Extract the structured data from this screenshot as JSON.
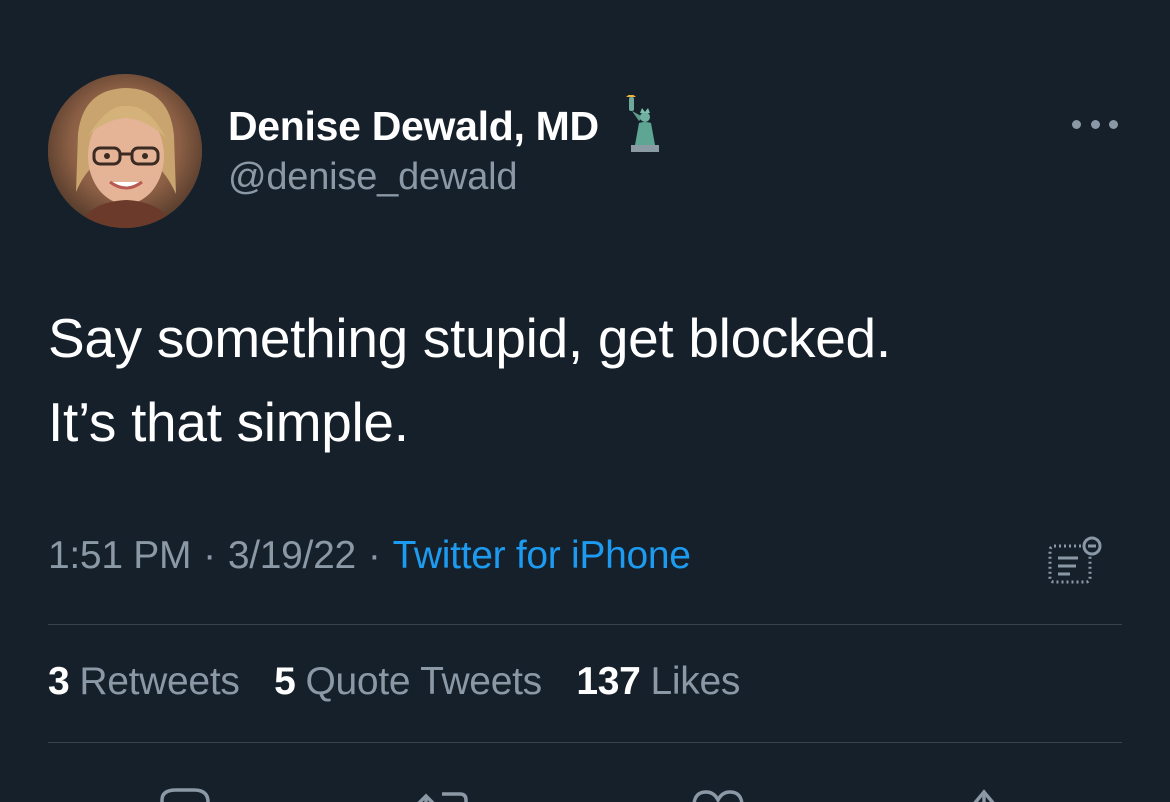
{
  "author": {
    "display_name": "Denise Dewald, MD",
    "handle": "@denise_dewald",
    "badge_icon": "statue-of-liberty-emoji"
  },
  "tweet": {
    "text_lines": [
      "Say something stupid, get blocked.",
      "It’s that simple."
    ]
  },
  "meta": {
    "time": "1:51 PM",
    "date": "3/19/22",
    "separator": "·",
    "source": "Twitter for iPhone"
  },
  "stats": {
    "retweets": {
      "count": "3",
      "label": "Retweets"
    },
    "quotes": {
      "count": "5",
      "label": "Quote Tweets"
    },
    "likes": {
      "count": "137",
      "label": "Likes"
    }
  },
  "colors": {
    "background": "#15202b",
    "text_primary": "#ffffff",
    "text_secondary": "#8b98a5",
    "link": "#1d9bf0",
    "divider": "#38444d"
  },
  "icons": {
    "more": "more-horizontal-icon",
    "analytics": "analytics-icon",
    "reply": "reply-icon",
    "retweet": "retweet-icon",
    "like": "heart-icon",
    "share": "share-icon"
  }
}
